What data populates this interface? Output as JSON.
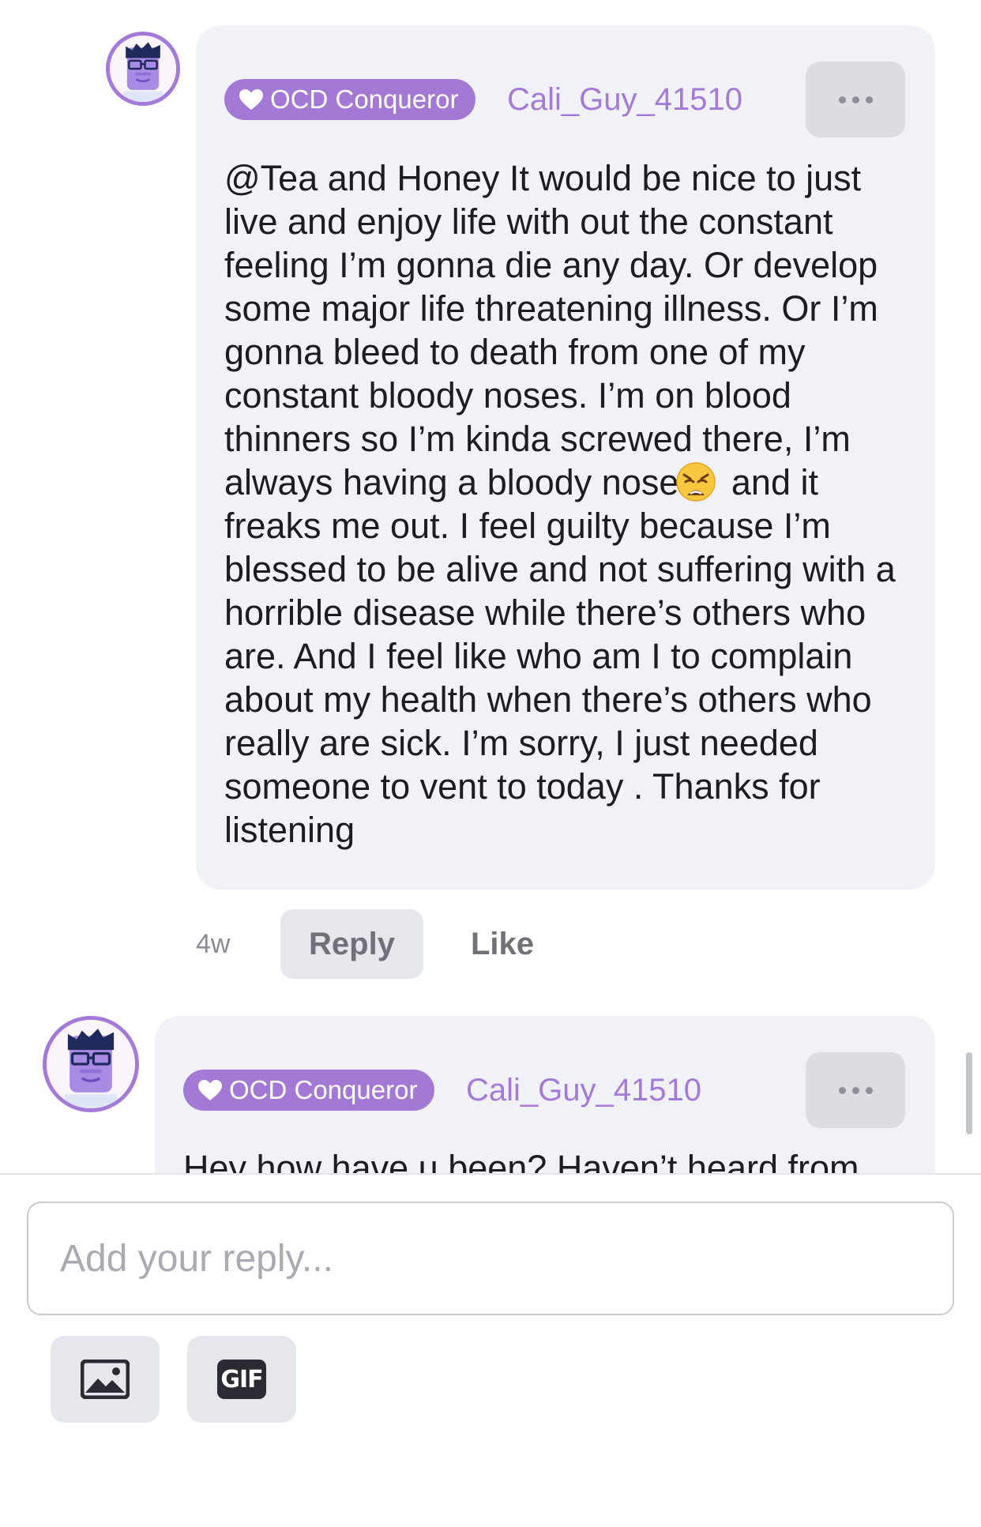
{
  "comments": [
    {
      "badge": "OCD Conqueror",
      "username": "Cali_Guy_41510",
      "text_before_emoji": "@Tea and Honey It would be nice to just live and enjoy life with out the constant feeling I’m gonna die any day. Or develop some major life threatening illness. Or I’m gonna bleed to death from one of my constant bloody noses. I’m on blood thinners so I’m kinda screwed there, I’m always having a bloody nose",
      "emoji": "weary-face-emoji",
      "text_after_emoji": " and it freaks me out. I feel guilty because I’m blessed to be alive and not suffering with a horrible disease while there’s others who are. And I feel like who am I to complain about my health when there’s others who really are sick. I’m sorry, I just needed someone to vent to today . Thanks for listening",
      "time": "4w",
      "reply_label": "Reply",
      "like_label": "Like"
    },
    {
      "badge": "OCD Conqueror",
      "username": "Cali_Guy_41510",
      "text_visible": "Hey how have u been? Haven’t heard from"
    }
  ],
  "composer": {
    "placeholder": "Add your reply...",
    "image_button_icon": "image-icon",
    "gif_label": "GIF"
  },
  "colors": {
    "accent": "#a47ad8",
    "bubble": "#f1f2f8",
    "button_bg": "#e6e7ec"
  }
}
